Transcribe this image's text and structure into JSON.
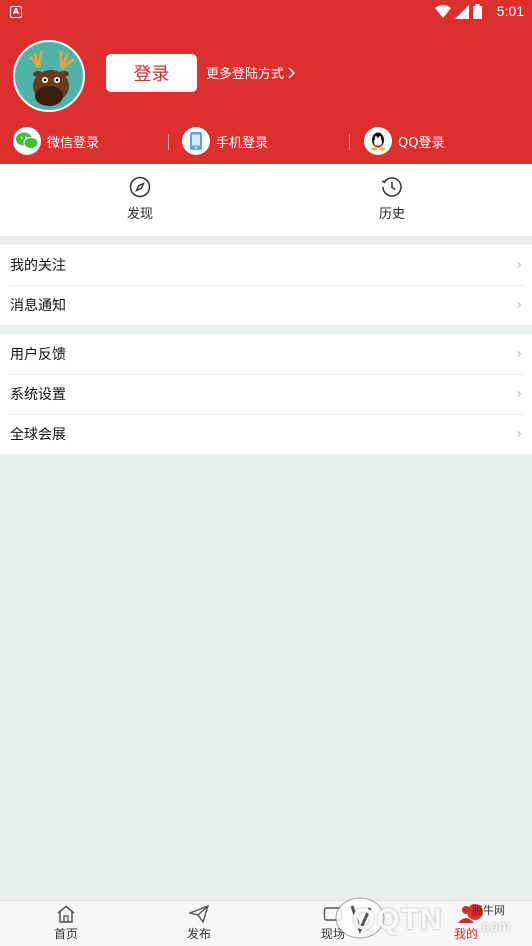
{
  "status_bar": {
    "time": "5:01"
  },
  "header": {
    "login_label": "登录",
    "more_login_label": "更多登陆方式",
    "methods": [
      {
        "label": "微信登录",
        "icon": "wechat-icon"
      },
      {
        "label": "手机登录",
        "icon": "phone-icon"
      },
      {
        "label": "QQ登录",
        "icon": "qq-icon"
      }
    ]
  },
  "quick_links": [
    {
      "label": "发现",
      "icon": "compass-icon"
    },
    {
      "label": "历史",
      "icon": "history-icon"
    }
  ],
  "menu_group_1": [
    {
      "label": "我的关注"
    },
    {
      "label": "消息通知"
    }
  ],
  "menu_group_2": [
    {
      "label": "用户反馈"
    },
    {
      "label": "系统设置"
    },
    {
      "label": "全球会展"
    }
  ],
  "tabbar": {
    "items": [
      {
        "label": "首页",
        "icon": "home-icon"
      },
      {
        "label": "发布",
        "icon": "send-icon"
      },
      {
        "label": "现场",
        "icon": "live-icon"
      },
      {
        "label": "我的",
        "icon": "person-icon"
      }
    ]
  },
  "watermark": {
    "text": "QQTN",
    "site": "腾牛网",
    "suffix": ".com"
  },
  "colors": {
    "brand_red": "#de2f2f",
    "background": "#e9eded"
  }
}
